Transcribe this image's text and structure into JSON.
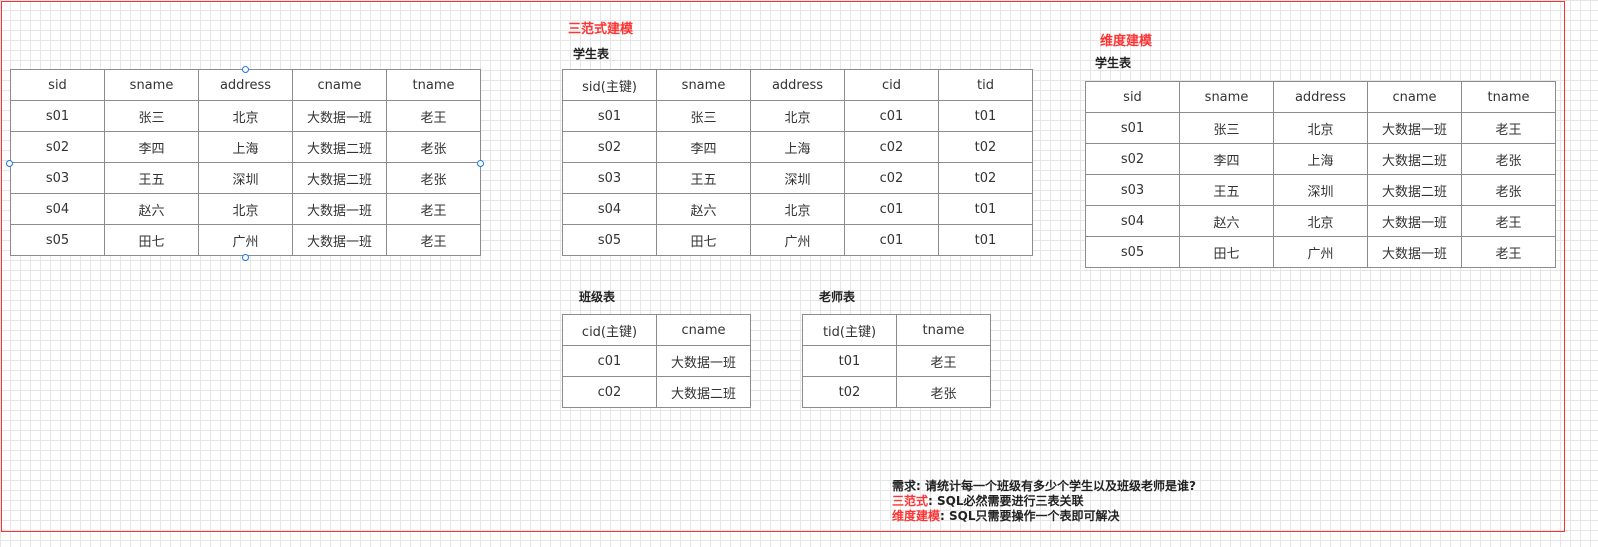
{
  "titles": {
    "normal_form": "三范式建模",
    "dimension": "维度建模"
  },
  "labels": {
    "nf_student": "学生表",
    "nf_class": "班级表",
    "nf_teacher": "老师表",
    "dim_student": "学生表"
  },
  "wide_table": {
    "headers": [
      "sid",
      "sname",
      "address",
      "cname",
      "tname"
    ],
    "rows": [
      [
        "s01",
        "张三",
        "北京",
        "大数据一班",
        "老王"
      ],
      [
        "s02",
        "李四",
        "上海",
        "大数据二班",
        "老张"
      ],
      [
        "s03",
        "王五",
        "深圳",
        "大数据二班",
        "老张"
      ],
      [
        "s04",
        "赵六",
        "北京",
        "大数据一班",
        "老王"
      ],
      [
        "s05",
        "田七",
        "广州",
        "大数据一班",
        "老王"
      ]
    ]
  },
  "nf_student_table": {
    "headers": [
      "sid(主键)",
      "sname",
      "address",
      "cid",
      "tid"
    ],
    "rows": [
      [
        "s01",
        "张三",
        "北京",
        "c01",
        "t01"
      ],
      [
        "s02",
        "李四",
        "上海",
        "c02",
        "t02"
      ],
      [
        "s03",
        "王五",
        "深圳",
        "c02",
        "t02"
      ],
      [
        "s04",
        "赵六",
        "北京",
        "c01",
        "t01"
      ],
      [
        "s05",
        "田七",
        "广州",
        "c01",
        "t01"
      ]
    ]
  },
  "nf_class_table": {
    "headers": [
      "cid(主键)",
      "cname"
    ],
    "rows": [
      [
        "c01",
        "大数据一班"
      ],
      [
        "c02",
        "大数据二班"
      ]
    ]
  },
  "nf_teacher_table": {
    "headers": [
      "tid(主键)",
      "tname"
    ],
    "rows": [
      [
        "t01",
        "老王"
      ],
      [
        "t02",
        "老张"
      ]
    ]
  },
  "dim_student_table": {
    "headers": [
      "sid",
      "sname",
      "address",
      "cname",
      "tname"
    ],
    "rows": [
      [
        "s01",
        "张三",
        "北京",
        "大数据一班",
        "老王"
      ],
      [
        "s02",
        "李四",
        "上海",
        "大数据二班",
        "老张"
      ],
      [
        "s03",
        "王五",
        "深圳",
        "大数据二班",
        "老张"
      ],
      [
        "s04",
        "赵六",
        "北京",
        "大数据一班",
        "老王"
      ],
      [
        "s05",
        "田七",
        "广州",
        "大数据一班",
        "老王"
      ]
    ]
  },
  "notes": {
    "line1": "需求: 请统计每一个班级有多少个学生以及班级老师是谁?",
    "line2_label": "三范式",
    "line2_text": ": SQL必然需要进行三表关联",
    "line3_label": "维度建模",
    "line3_text": ": SQL只需要操作一个表即可解决"
  },
  "colors": {
    "accent_red": "#ff3333",
    "selection_blue": "#1a7ae0",
    "cell_border": "#8c8c8c"
  }
}
